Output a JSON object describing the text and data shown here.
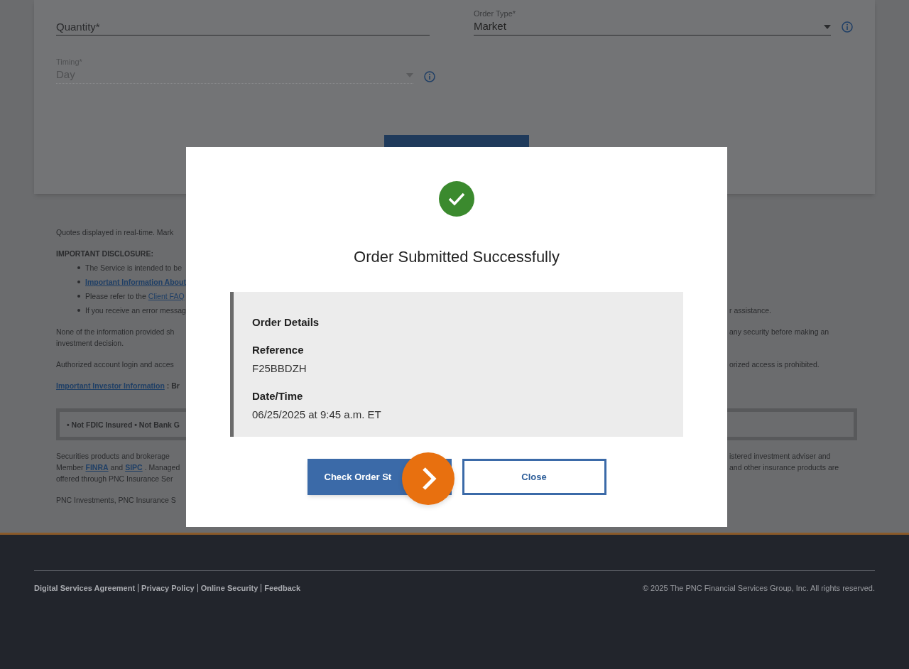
{
  "order_form": {
    "quantity": {
      "placeholder": "Quantity*"
    },
    "order_type": {
      "label": "Order Type*",
      "value": "Market"
    },
    "timing": {
      "label": "Timing*",
      "value": "Day",
      "disabled": true
    }
  },
  "disclosures": [
    {
      "kind": "paragraph",
      "left": [
        {
          "kind": "text",
          "text": "Quotes displayed in real-time. Mark"
        }
      ]
    },
    {
      "kind": "heading",
      "left": [
        {
          "kind": "bold",
          "text": "IMPORTANT DISCLOSURE:"
        }
      ]
    },
    {
      "kind": "bullet",
      "left": [
        {
          "kind": "text",
          "text": "The Service is intended to be"
        }
      ]
    },
    {
      "kind": "bullet",
      "left": [
        {
          "kind": "bold-link",
          "text": "Important Information About"
        }
      ]
    },
    {
      "kind": "bullet",
      "left": [
        {
          "kind": "text",
          "text": "Please refer to the"
        },
        {
          "kind": "link",
          "text": "Client FAQ"
        }
      ]
    },
    {
      "kind": "bullet",
      "left": [
        {
          "kind": "text",
          "text": "If you receive an error messag"
        }
      ],
      "right": "r assistance."
    },
    {
      "kind": "paragraph",
      "left": [
        {
          "kind": "text",
          "text": "None of the information provided sh"
        }
      ],
      "right": "any security before making an"
    },
    {
      "kind": "continuation",
      "left": [
        {
          "kind": "text",
          "text": "investment decision."
        }
      ]
    },
    {
      "kind": "paragraph",
      "left": [
        {
          "kind": "text",
          "text": "Authorized account login and acces"
        }
      ],
      "right": "orized access is prohibited."
    },
    {
      "kind": "paragraph",
      "left": [
        {
          "kind": "bold-link",
          "text": "Important Investor Information"
        },
        {
          "kind": "bold",
          "text": ": Br"
        }
      ]
    },
    {
      "kind": "notice",
      "left": [
        {
          "kind": "bold",
          "text": "• Not FDIC Insured • Not Bank G"
        }
      ]
    },
    {
      "kind": "paragraph",
      "left": [
        {
          "kind": "text",
          "text": "Securities products and brokerage"
        }
      ],
      "right": "istered investment adviser and"
    },
    {
      "kind": "continuation",
      "left": [
        {
          "kind": "text",
          "text": "Member"
        },
        {
          "kind": "bold-link",
          "text": "FINRA"
        },
        {
          "kind": "text",
          "text": "and"
        },
        {
          "kind": "bold-link",
          "text": "SIPC"
        },
        {
          "kind": "text",
          "text": ". Managed"
        }
      ],
      "right": "and other insurance products are"
    },
    {
      "kind": "continuation",
      "left": [
        {
          "kind": "text",
          "text": "offered through PNC Insurance Ser"
        }
      ]
    },
    {
      "kind": "paragraph",
      "left": [
        {
          "kind": "text",
          "text": "PNC Investments, PNC Insurance S"
        }
      ]
    }
  ],
  "modal": {
    "title": "Order Submitted Successfully",
    "details": {
      "heading": "Order Details",
      "fields": [
        {
          "label": "Reference",
          "value": "F25BBDZH"
        },
        {
          "label": "Date/Time",
          "value": "06/25/2025 at 9:45 a.m. ET"
        }
      ]
    },
    "buttons": [
      {
        "label": "Check Order St",
        "kind": "primary"
      },
      {
        "label": "Close",
        "kind": "secondary"
      }
    ]
  },
  "footer": {
    "links": [
      "Digital Services Agreement",
      "Privacy Policy",
      "Online Security",
      "Feedback"
    ],
    "copyright": "© 2025 The PNC Financial Services Group, Inc. All rights reserved."
  }
}
